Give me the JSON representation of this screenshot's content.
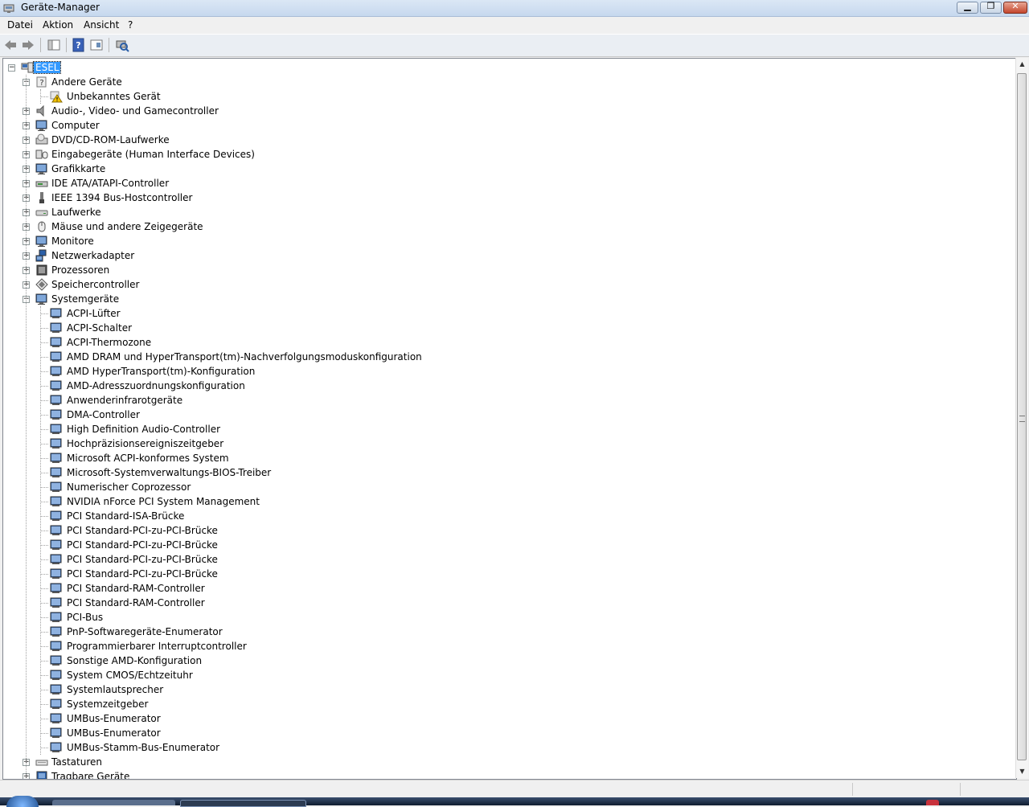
{
  "window": {
    "title": "Geräte-Manager"
  },
  "menu": [
    "Datei",
    "Aktion",
    "Ansicht",
    "?"
  ],
  "toolbar": [
    "back-icon",
    "forward-icon",
    "show-hide-console-tree-icon",
    "help-icon",
    "properties-icon",
    "scan-hardware-icon"
  ],
  "tree": {
    "root": "ESEL",
    "categories": [
      {
        "label": "Andere Geräte",
        "expanded": true,
        "icon": "unknown-device-icon",
        "children": [
          "Unbekanntes Gerät"
        ]
      },
      {
        "label": "Audio-, Video- und Gamecontroller",
        "icon": "speaker-icon"
      },
      {
        "label": "Computer",
        "icon": "computer-icon"
      },
      {
        "label": "DVD/CD-ROM-Laufwerke",
        "icon": "optical-drive-icon"
      },
      {
        "label": "Eingabegeräte (Human Interface Devices)",
        "icon": "hid-icon"
      },
      {
        "label": "Grafikkarte",
        "icon": "display-adapter-icon"
      },
      {
        "label": "IDE ATA/ATAPI-Controller",
        "icon": "ide-controller-icon"
      },
      {
        "label": "IEEE 1394 Bus-Hostcontroller",
        "icon": "firewire-icon"
      },
      {
        "label": "Laufwerke",
        "icon": "disk-drive-icon"
      },
      {
        "label": "Mäuse und andere Zeigegeräte",
        "icon": "mouse-icon"
      },
      {
        "label": "Monitore",
        "icon": "monitor-icon"
      },
      {
        "label": "Netzwerkadapter",
        "icon": "network-adapter-icon"
      },
      {
        "label": "Prozessoren",
        "icon": "processor-icon"
      },
      {
        "label": "Speichercontroller",
        "icon": "storage-controller-icon"
      },
      {
        "label": "Systemgeräte",
        "expanded": true,
        "icon": "system-device-icon",
        "children": [
          "ACPI-Lüfter",
          "ACPI-Schalter",
          "ACPI-Thermozone",
          "AMD DRAM und HyperTransport(tm)-Nachverfolgungsmoduskonfiguration",
          "AMD HyperTransport(tm)-Konfiguration",
          "AMD-Adresszuordnungskonfiguration",
          "Anwenderinfrarotgeräte",
          "DMA-Controller",
          "High Definition Audio-Controller",
          "Hochpräzisionsereigniszeitgeber",
          "Microsoft ACPI-konformes System",
          "Microsoft-Systemverwaltungs-BIOS-Treiber",
          "Numerischer Coprozessor",
          "NVIDIA nForce PCI System Management",
          "PCI Standard-ISA-Brücke",
          "PCI Standard-PCI-zu-PCI-Brücke",
          "PCI Standard-PCI-zu-PCI-Brücke",
          "PCI Standard-PCI-zu-PCI-Brücke",
          "PCI Standard-PCI-zu-PCI-Brücke",
          "PCI Standard-RAM-Controller",
          "PCI Standard-RAM-Controller",
          "PCI-Bus",
          "PnP-Softwaregeräte-Enumerator",
          "Programmierbarer Interruptcontroller",
          "Sonstige AMD-Konfiguration",
          "System CMOS/Echtzeituhr",
          "Systemlautsprecher",
          "Systemzeitgeber",
          "UMBus-Enumerator",
          "UMBus-Enumerator",
          "UMBus-Stamm-Bus-Enumerator"
        ]
      },
      {
        "label": "Tastaturen",
        "icon": "keyboard-icon"
      },
      {
        "label": "Tragbare Geräte",
        "icon": "portable-device-icon"
      }
    ]
  }
}
